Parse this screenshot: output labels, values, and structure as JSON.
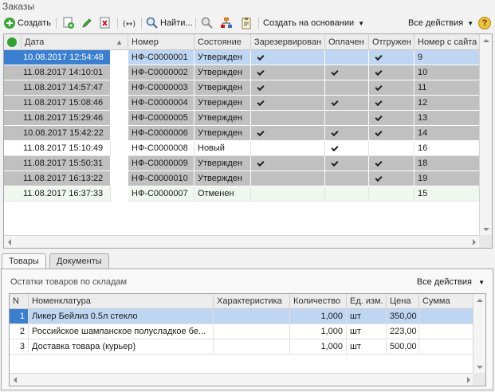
{
  "window": {
    "title": "Заказы"
  },
  "toolbar": {
    "create_label": "Создать",
    "find_label": "Найти...",
    "create_based_label": "Создать на основании",
    "all_actions_label": "Все действия",
    "help_label": "?"
  },
  "orders": {
    "columns": [
      "Дата",
      "Номер",
      "Состояние",
      "Зарезервирован",
      "Оплачен",
      "Отгружен",
      "Номер с сайта"
    ],
    "rows": [
      {
        "date": "10.08.2017 12:54:48",
        "number": "НФ-С0000001",
        "state": "Утвержден",
        "reserved": true,
        "paid": false,
        "shipped": true,
        "site_number": "9",
        "style": "sel",
        "icon": "posted"
      },
      {
        "date": "11.08.2017 14:10:01",
        "number": "НФ-С0000002",
        "state": "Утвержден",
        "reserved": true,
        "paid": true,
        "shipped": true,
        "site_number": "10",
        "style": "gray",
        "icon": "posted"
      },
      {
        "date": "11.08.2017 14:57:47",
        "number": "НФ-С0000003",
        "state": "Утвержден",
        "reserved": true,
        "paid": false,
        "shipped": true,
        "site_number": "11",
        "style": "gray",
        "icon": "posted"
      },
      {
        "date": "11.08.2017 15:08:46",
        "number": "НФ-С0000004",
        "state": "Утвержден",
        "reserved": true,
        "paid": true,
        "shipped": true,
        "site_number": "12",
        "style": "gray",
        "icon": "posted"
      },
      {
        "date": "11.08.2017 15:29:46",
        "number": "НФ-С0000005",
        "state": "Утвержден",
        "reserved": false,
        "paid": false,
        "shipped": true,
        "site_number": "13",
        "style": "gray",
        "icon": "posted"
      },
      {
        "date": "10.08.2017 15:42:22",
        "number": "НФ-С0000006",
        "state": "Утвержден",
        "reserved": true,
        "paid": true,
        "shipped": true,
        "site_number": "14",
        "style": "gray",
        "icon": "posted"
      },
      {
        "date": "11.08.2017 15:10:49",
        "number": "НФ-С0000008",
        "state": "Новый",
        "reserved": false,
        "paid": true,
        "shipped": false,
        "site_number": "16",
        "style": "white",
        "icon": "draft"
      },
      {
        "date": "11.08.2017 15:50:31",
        "number": "НФ-С0000009",
        "state": "Утвержден",
        "reserved": true,
        "paid": true,
        "shipped": true,
        "site_number": "18",
        "style": "gray",
        "icon": "posted"
      },
      {
        "date": "11.08.2017 16:13:22",
        "number": "НФ-С0000010",
        "state": "Утвержден",
        "reserved": false,
        "paid": false,
        "shipped": true,
        "site_number": "19",
        "style": "gray",
        "icon": "posted"
      },
      {
        "date": "11.08.2017 16:37:33",
        "number": "НФ-С0000007",
        "state": "Отменен",
        "reserved": false,
        "paid": false,
        "shipped": false,
        "site_number": "15",
        "style": "green",
        "icon": "deleted"
      }
    ]
  },
  "tabs": [
    {
      "label": "Товары",
      "active": true
    },
    {
      "label": "Документы",
      "active": false
    }
  ],
  "stock_panel": {
    "title": "Остатки товаров по складам",
    "all_actions_label": "Все действия",
    "columns": [
      "N",
      "Номенклатура",
      "Характеристика",
      "Количество",
      "Ед. изм.",
      "Цена",
      "Сумма"
    ],
    "rows": [
      {
        "n": "1",
        "item": "Ликер Бейлиз 0.5л стекло",
        "feature": "",
        "qty": "1,000",
        "unit": "шт",
        "price": "350,00",
        "sum": ""
      },
      {
        "n": "2",
        "item": "Российское шампанское полусладкое бе...",
        "feature": "",
        "qty": "1,000",
        "unit": "шт",
        "price": "223,00",
        "sum": ""
      },
      {
        "n": "3",
        "item": "Доставка товара (курьер)",
        "feature": "",
        "qty": "1,000",
        "unit": "шт",
        "price": "500,00",
        "sum": ""
      }
    ]
  }
}
